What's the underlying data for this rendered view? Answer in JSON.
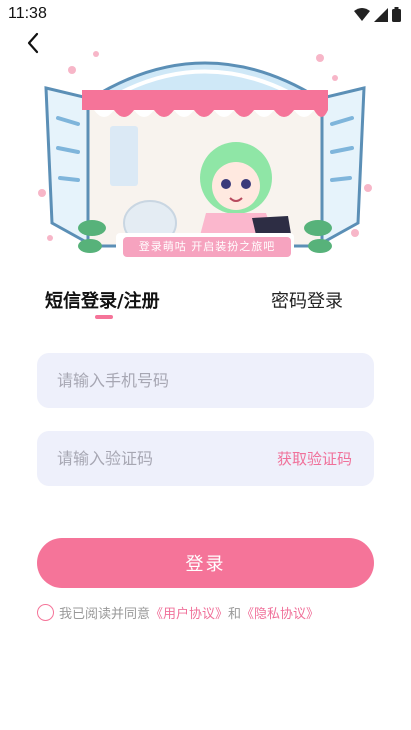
{
  "status_bar": {
    "time": "11:38"
  },
  "hero": {
    "banner_text": "登录萌咕 开启装扮之旅吧"
  },
  "tabs": {
    "sms_label": "短信登录/注册",
    "password_label": "密码登录"
  },
  "phone": {
    "placeholder": "请输入手机号码"
  },
  "code": {
    "placeholder": "请输入验证码",
    "get_code_label": "获取验证码"
  },
  "login_button": {
    "label": "登录"
  },
  "agreement": {
    "prefix": "我已阅读并同意",
    "user_agreement": "《用户协议》",
    "and": "和",
    "privacy_policy": "《隐私协议》"
  },
  "colors": {
    "accent": "#f57499",
    "field_bg": "#eef0fb",
    "link": "#f0719a"
  }
}
